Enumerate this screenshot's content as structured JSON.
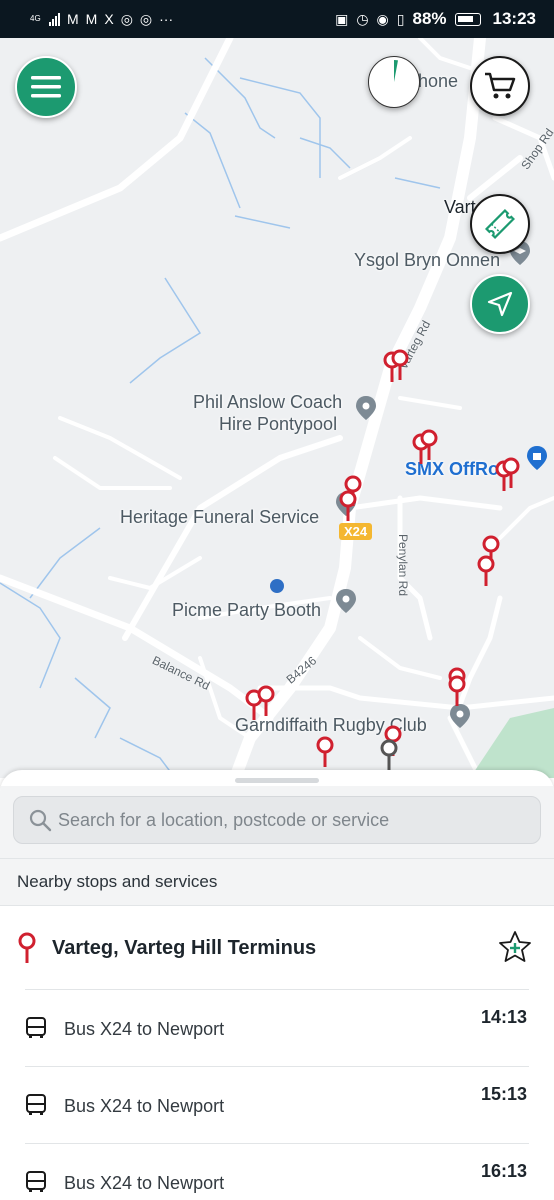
{
  "status_bar": {
    "network": "4G",
    "apps": [
      "M",
      "M",
      "X"
    ],
    "battery": "88%",
    "time": "13:23"
  },
  "map": {
    "places": {
      "phone": "hone",
      "varteg": "Vart",
      "school": "Ysgol Bryn Onnen",
      "coach": [
        "Phil Anslow Coach",
        "Hire Pontypool"
      ],
      "smx": "SMX OffRo",
      "funeral": "Heritage Funeral Service",
      "party": "Picme Party Booth",
      "rugby": "Garndiffaith Rugby Club"
    },
    "roads": {
      "shop": "Shop Rd",
      "varteg": "Varteg Rd",
      "penylan": "Penylan Rd",
      "balance": "Balance Rd",
      "b4246": "B4246"
    },
    "route_badge": "X24",
    "accent_color": "#1c9a70",
    "stop_color": "#d0202f"
  },
  "sheet": {
    "search_placeholder": "Search for a location, postcode or service",
    "section_title": "Nearby stops and services",
    "stop_name": "Varteg, Varteg Hill Terminus",
    "services": [
      {
        "label": "Bus X24 to Newport",
        "time": "14:13"
      },
      {
        "label": "Bus X24 to Newport",
        "time": "15:13"
      },
      {
        "label": "Bus X24 to Newport",
        "time": "16:13"
      }
    ]
  }
}
